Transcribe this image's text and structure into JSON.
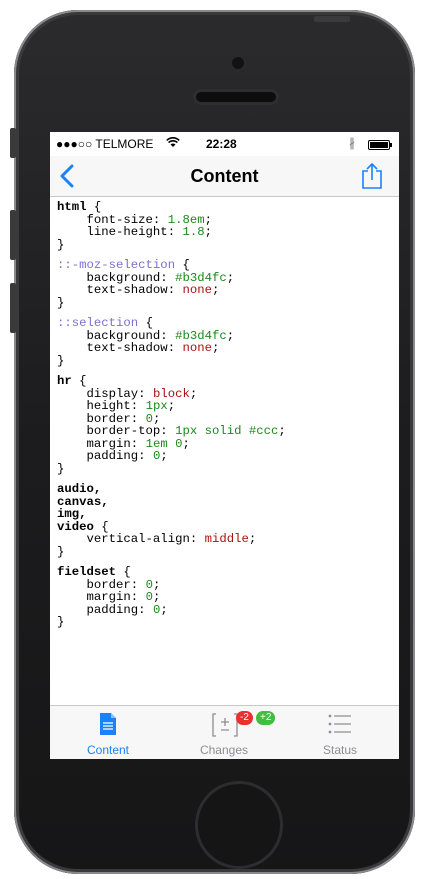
{
  "statusbar": {
    "carrier": "●●●○○ TELMORE",
    "time": "22:28"
  },
  "navbar": {
    "title": "Content"
  },
  "code": [
    {
      "lines": [
        [
          {
            "t": "html",
            "c": "sel"
          },
          {
            "t": " {",
            "c": ""
          }
        ],
        [
          {
            "t": "    font-size: ",
            "c": ""
          },
          {
            "t": "1.8em",
            "c": "val"
          },
          {
            "t": ";",
            "c": ""
          }
        ],
        [
          {
            "t": "    line-height: ",
            "c": ""
          },
          {
            "t": "1.8",
            "c": "val"
          },
          {
            "t": ";",
            "c": ""
          }
        ],
        [
          {
            "t": "}",
            "c": ""
          }
        ]
      ]
    },
    {
      "lines": [
        [
          {
            "t": "::-moz-selection",
            "c": "pseudo"
          },
          {
            "t": " {",
            "c": ""
          }
        ],
        [
          {
            "t": "    background: ",
            "c": ""
          },
          {
            "t": "#b3d4fc",
            "c": "val"
          },
          {
            "t": ";",
            "c": ""
          }
        ],
        [
          {
            "t": "    text-shadow: ",
            "c": ""
          },
          {
            "t": "none",
            "c": "kw"
          },
          {
            "t": ";",
            "c": ""
          }
        ],
        [
          {
            "t": "}",
            "c": ""
          }
        ]
      ]
    },
    {
      "lines": [
        [
          {
            "t": "::selection",
            "c": "pseudo"
          },
          {
            "t": " {",
            "c": ""
          }
        ],
        [
          {
            "t": "    background: ",
            "c": ""
          },
          {
            "t": "#b3d4fc",
            "c": "val"
          },
          {
            "t": ";",
            "c": ""
          }
        ],
        [
          {
            "t": "    text-shadow: ",
            "c": ""
          },
          {
            "t": "none",
            "c": "kw"
          },
          {
            "t": ";",
            "c": ""
          }
        ],
        [
          {
            "t": "}",
            "c": ""
          }
        ]
      ]
    },
    {
      "lines": [
        [
          {
            "t": "hr",
            "c": "sel"
          },
          {
            "t": " {",
            "c": ""
          }
        ],
        [
          {
            "t": "    display: ",
            "c": ""
          },
          {
            "t": "block",
            "c": "kw"
          },
          {
            "t": ";",
            "c": ""
          }
        ],
        [
          {
            "t": "    height: ",
            "c": ""
          },
          {
            "t": "1px",
            "c": "val"
          },
          {
            "t": ";",
            "c": ""
          }
        ],
        [
          {
            "t": "    border: ",
            "c": ""
          },
          {
            "t": "0",
            "c": "val"
          },
          {
            "t": ";",
            "c": ""
          }
        ],
        [
          {
            "t": "    border-top: ",
            "c": ""
          },
          {
            "t": "1px solid #ccc",
            "c": "val"
          },
          {
            "t": ";",
            "c": ""
          }
        ],
        [
          {
            "t": "    margin: ",
            "c": ""
          },
          {
            "t": "1em 0",
            "c": "val"
          },
          {
            "t": ";",
            "c": ""
          }
        ],
        [
          {
            "t": "    padding: ",
            "c": ""
          },
          {
            "t": "0",
            "c": "val"
          },
          {
            "t": ";",
            "c": ""
          }
        ],
        [
          {
            "t": "}",
            "c": ""
          }
        ]
      ]
    },
    {
      "lines": [
        [
          {
            "t": "audio,",
            "c": "sel"
          }
        ],
        [
          {
            "t": "canvas,",
            "c": "sel"
          }
        ],
        [
          {
            "t": "img,",
            "c": "sel"
          }
        ],
        [
          {
            "t": "video",
            "c": "sel"
          },
          {
            "t": " {",
            "c": ""
          }
        ],
        [
          {
            "t": "    vertical-align: ",
            "c": ""
          },
          {
            "t": "middle",
            "c": "kw"
          },
          {
            "t": ";",
            "c": ""
          }
        ],
        [
          {
            "t": "}",
            "c": ""
          }
        ]
      ]
    },
    {
      "lines": [
        [
          {
            "t": "fieldset",
            "c": "sel"
          },
          {
            "t": " {",
            "c": ""
          }
        ],
        [
          {
            "t": "    border: ",
            "c": ""
          },
          {
            "t": "0",
            "c": "val"
          },
          {
            "t": ";",
            "c": ""
          }
        ],
        [
          {
            "t": "    margin: ",
            "c": ""
          },
          {
            "t": "0",
            "c": "val"
          },
          {
            "t": ";",
            "c": ""
          }
        ],
        [
          {
            "t": "    padding: ",
            "c": ""
          },
          {
            "t": "0",
            "c": "val"
          },
          {
            "t": ";",
            "c": ""
          }
        ],
        [
          {
            "t": "}",
            "c": ""
          }
        ]
      ]
    }
  ],
  "tabbar": {
    "tabs": [
      {
        "label": "Content",
        "icon": "document-icon",
        "active": true
      },
      {
        "label": "Changes",
        "icon": "diff-icon",
        "active": false
      },
      {
        "label": "Status",
        "icon": "list-icon",
        "active": false
      }
    ],
    "badge_removed": "-2",
    "badge_added": "+2"
  },
  "colors": {
    "accent": "#1a82fb",
    "badge_removed": "#e8312f",
    "badge_added": "#3fbf3f"
  }
}
